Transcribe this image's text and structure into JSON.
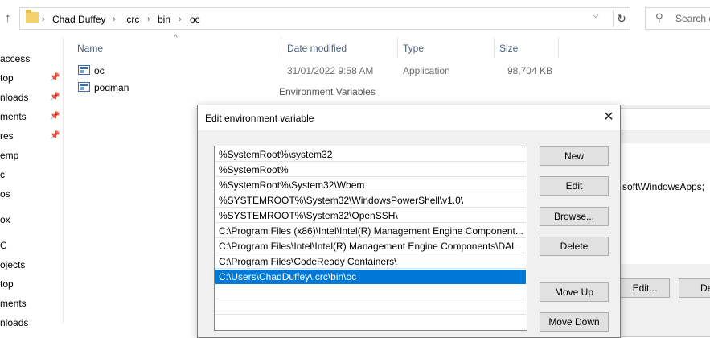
{
  "explorer": {
    "breadcrumbs": [
      "Chad Duffey",
      ".crc",
      "bin",
      "oc"
    ],
    "search_placeholder": "Search c",
    "nav_items": [
      {
        "label": "access",
        "pinned": false
      },
      {
        "label": "top",
        "pinned": true
      },
      {
        "label": "nloads",
        "pinned": true
      },
      {
        "label": "ments",
        "pinned": true
      },
      {
        "label": "res",
        "pinned": true
      },
      {
        "label": "emp",
        "pinned": false
      },
      {
        "label": "c",
        "pinned": false
      },
      {
        "label": "os",
        "pinned": false
      },
      {
        "label": "ox",
        "pinned": false
      },
      {
        "label": "C",
        "pinned": false
      },
      {
        "label": "ojects",
        "pinned": false
      },
      {
        "label": "top",
        "pinned": false
      },
      {
        "label": "ments",
        "pinned": false
      },
      {
        "label": "nloads",
        "pinned": false
      }
    ],
    "columns": {
      "name": "Name",
      "date": "Date modified",
      "type": "Type",
      "size": "Size"
    },
    "files": [
      {
        "name": "oc",
        "date": "31/01/2022 9:58 AM",
        "type": "Application",
        "size": "98,704 KB"
      },
      {
        "name": "podman",
        "date": "",
        "type": "",
        "size": ""
      }
    ]
  },
  "env_window": {
    "title": "Environment Variables",
    "path_value_fragment": "soft\\WindowsApps;",
    "edit_label": "Edit...",
    "delete_label": "De"
  },
  "dialog": {
    "title": "Edit environment variable",
    "close_glyph": "✕",
    "paths": [
      "%SystemRoot%\\system32",
      "%SystemRoot%",
      "%SystemRoot%\\System32\\Wbem",
      "%SYSTEMROOT%\\System32\\WindowsPowerShell\\v1.0\\",
      "%SYSTEMROOT%\\System32\\OpenSSH\\",
      "C:\\Program Files (x86)\\Intel\\Intel(R) Management Engine Component...",
      "C:\\Program Files\\Intel\\Intel(R) Management Engine Components\\DAL",
      "C:\\Program Files\\CodeReady Containers\\",
      "C:\\Users\\ChadDuffey\\.crc\\bin\\oc",
      "",
      ""
    ],
    "selected_index": 8,
    "buttons": {
      "new": "New",
      "edit": "Edit",
      "browse": "Browse...",
      "delete": "Delete",
      "move_up": "Move Up",
      "move_down": "Move Down"
    }
  }
}
